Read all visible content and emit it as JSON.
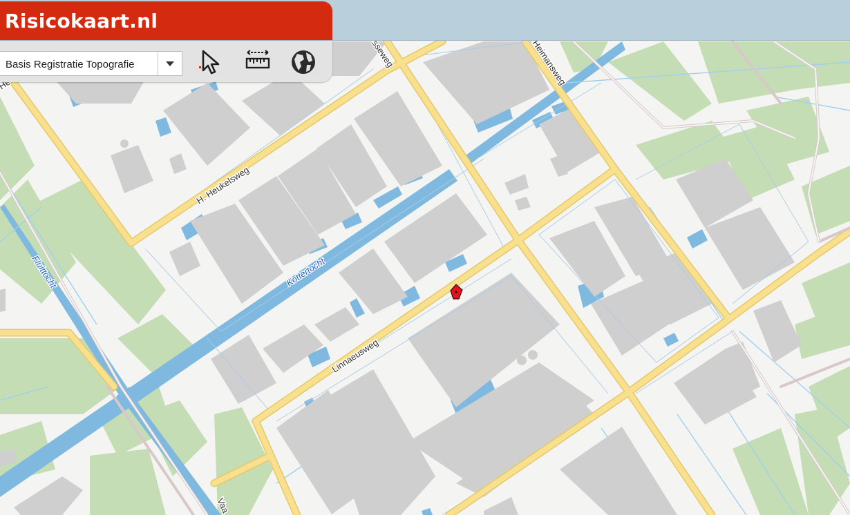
{
  "app": {
    "brand": "Risicokaart.nl"
  },
  "toolbar": {
    "layer_select_value": "Basis Registratie Topografie",
    "tools": [
      {
        "name": "select-tool",
        "icon": "cursor-icon"
      },
      {
        "name": "measure-tool",
        "icon": "ruler-icon"
      },
      {
        "name": "globe-tool",
        "icon": "globe-icon"
      }
    ]
  },
  "map": {
    "labels": {
      "heukelsweg": "H. Heukelsweg",
      "heimansweg": "Heimansweg",
      "linnaeusweg": "Linnaeusweg",
      "kottertocht": "Kottertocht",
      "fluittocht": "Fluittocht",
      "top_left_road": "He",
      "top_road": "sseweg",
      "bottom_road": "Vaa"
    },
    "colors": {
      "background": "#f4f4f2",
      "building": "#cfcfcf",
      "green": "#c5ddb4",
      "water": "#7fb9e0",
      "road": "#f8e08e",
      "marker": "#e8101b",
      "brand": "#d42a0f",
      "header": "#b9cfdc"
    }
  }
}
